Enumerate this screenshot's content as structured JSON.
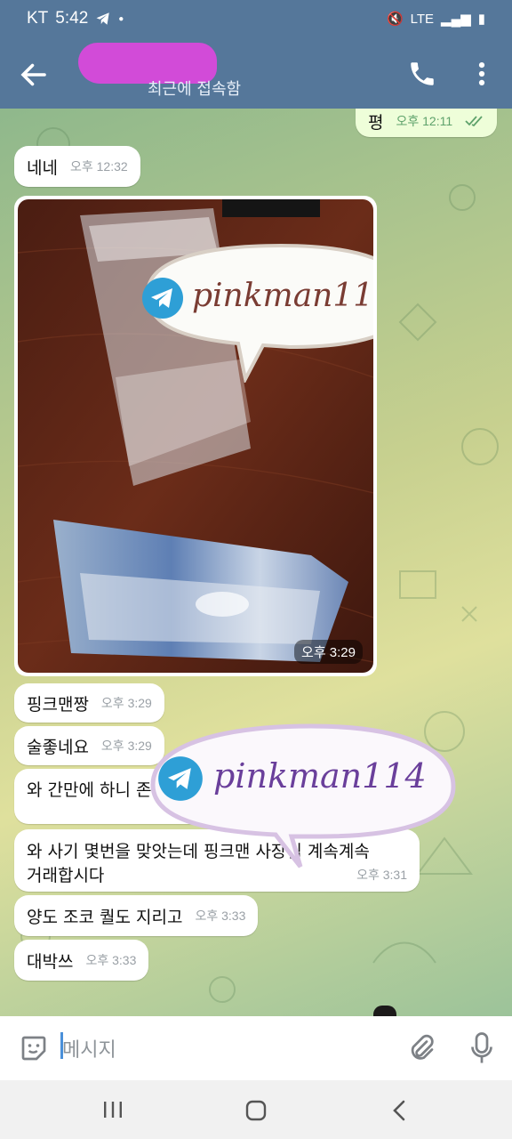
{
  "status": {
    "carrier": "KT",
    "time": "5:42",
    "network": "LTE"
  },
  "header": {
    "subtitle": "최근에 접속함"
  },
  "messages": [
    {
      "text": "평",
      "time": "오후 12:11",
      "out": true
    },
    {
      "text": "네네",
      "time": "오후 12:32"
    },
    {
      "text": "핑크맨짱",
      "time": "오후 3:29"
    },
    {
      "text": "술좋네요",
      "time": "오후 3:29"
    },
    {
      "text": "와 간만에 하니 존",
      "time": ""
    },
    {
      "text": "와 사기 몇번을 맞앗는데 핑크맨 사장님 계속계속",
      "text2": "거래합시다",
      "time": "오후 3:31"
    },
    {
      "text": "양도 조코 퀄도 지리고",
      "time": "오후 3:33"
    },
    {
      "text": "대박쓰",
      "time": "오후 3:33"
    }
  ],
  "photo": {
    "time": "오후 3:29"
  },
  "watermark": {
    "text": "pinkman114"
  },
  "input": {
    "placeholder": "메시지"
  },
  "colors": {
    "header": "#55779a",
    "outgoing_bubble": "#eefed9",
    "watermark_text": "#7a3c33",
    "watermark_text2": "#6a3f9b"
  }
}
